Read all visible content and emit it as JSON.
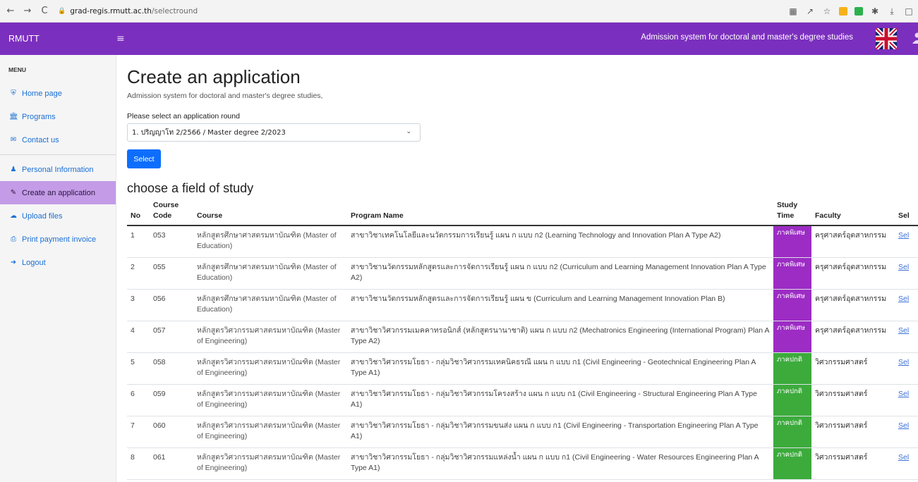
{
  "browser": {
    "url_host": "grad-regis.rmutt.ac.th",
    "url_path": "/selectround"
  },
  "header": {
    "brand": "RMUTT",
    "title": "Admission system for doctoral and master's degree studies"
  },
  "sidebar": {
    "heading": "MENU",
    "items": [
      {
        "label": "Home page",
        "icon": "home-icon"
      },
      {
        "label": "Programs",
        "icon": "university-icon"
      },
      {
        "label": "Contact us",
        "icon": "envelope-icon"
      },
      {
        "label": "Personal Information",
        "icon": "user-icon"
      },
      {
        "label": "Create an application",
        "icon": "file-signature-icon",
        "active": true
      },
      {
        "label": "Upload files",
        "icon": "cloud-upload-icon"
      },
      {
        "label": "Print payment invoice",
        "icon": "print-icon"
      },
      {
        "label": "Logout",
        "icon": "sign-out-icon"
      }
    ]
  },
  "main": {
    "title": "Create an application",
    "subtitle": "Admission system for doctoral and master's degree studies,",
    "round_label": "Please select an application round",
    "round_value": "1. ปริญญาโท 2/2566 / Master degree 2/2023",
    "select_button": "Select",
    "section_title": "choose a field of study"
  },
  "table": {
    "headers": {
      "no": "No",
      "code": "Course Code",
      "course": "Course",
      "program": "Program Name",
      "time": "Study Time",
      "faculty": "Faculty",
      "select": "Sel"
    },
    "rows": [
      {
        "no": "1",
        "code": "053",
        "course": "หลักสูตรศึกษาศาสตรมหาบัณฑิต (Master of Education)",
        "program": "สาขาวิชาเทคโนโลยีและนวัตกรรมการเรียนรู้ แผน ก แบบ ก2 (Learning Technology and Innovation Plan A Type A2)",
        "time": "ภาคพิเศษ",
        "time_type": "special",
        "faculty": "ครุศาสตร์อุตสาหกรรม",
        "select": "Sel"
      },
      {
        "no": "2",
        "code": "055",
        "course": "หลักสูตรศึกษาศาสตรมหาบัณฑิต (Master of Education)",
        "program": "สาขาวิชานวัตกรรมหลักสูตรและการจัดการเรียนรู้ แผน ก แบบ ก2 (Curriculum and Learning Management Innovation Plan A Type A2)",
        "time": "ภาคพิเศษ",
        "time_type": "special",
        "faculty": "ครุศาสตร์อุตสาหกรรม",
        "select": "Sel"
      },
      {
        "no": "3",
        "code": "056",
        "course": "หลักสูตรศึกษาศาสตรมหาบัณฑิต (Master of Education)",
        "program": "สาขาวิชานวัตกรรมหลักสูตรและการจัดการเรียนรู้ แผน ข (Curriculum and Learning Management Innovation Plan B)",
        "time": "ภาคพิเศษ",
        "time_type": "special",
        "faculty": "ครุศาสตร์อุตสาหกรรม",
        "select": "Sel"
      },
      {
        "no": "4",
        "code": "057",
        "course": "หลักสูตรวิศวกรรมศาสตรมหาบัณฑิต (Master of Engineering)",
        "program": "สาขาวิชาวิศวกรรมเมคคาทรอนิกส์ (หลักสูตรนานาชาติ) แผน ก แบบ ก2 (Mechatronics Engineering (International Program) Plan A Type A2)",
        "time": "ภาคพิเศษ",
        "time_type": "special",
        "faculty": "ครุศาสตร์อุตสาหกรรม",
        "select": "Sel"
      },
      {
        "no": "5",
        "code": "058",
        "course": "หลักสูตรวิศวกรรมศาสตรมหาบัณฑิต (Master of Engineering)",
        "program": "สาขาวิชาวิศวกรรมโยธา - กลุ่มวิชาวิศวกรรมเทคนิคธรณี แผน ก แบบ ก1 (Civil Engineering - Geotechnical Engineering Plan A Type A1)",
        "time": "ภาคปกติ",
        "time_type": "normal",
        "faculty": "วิศวกรรมศาสตร์",
        "select": "Sel"
      },
      {
        "no": "6",
        "code": "059",
        "course": "หลักสูตรวิศวกรรมศาสตรมหาบัณฑิต (Master of Engineering)",
        "program": "สาขาวิชาวิศวกรรมโยธา - กลุ่มวิชาวิศวกรรมโครงสร้าง แผน ก แบบ ก1 (Civil Engineering - Structural Engineering Plan A Type A1)",
        "time": "ภาคปกติ",
        "time_type": "normal",
        "faculty": "วิศวกรรมศาสตร์",
        "select": "Sel"
      },
      {
        "no": "7",
        "code": "060",
        "course": "หลักสูตรวิศวกรรมศาสตรมหาบัณฑิต (Master of Engineering)",
        "program": "สาขาวิชาวิศวกรรมโยธา - กลุ่มวิชาวิศวกรรมขนส่ง แผน ก แบบ ก1 (Civil Engineering - Transportation Engineering Plan A Type A1)",
        "time": "ภาคปกติ",
        "time_type": "normal",
        "faculty": "วิศวกรรมศาสตร์",
        "select": "Sel"
      },
      {
        "no": "8",
        "code": "061",
        "course": "หลักสูตรวิศวกรรมศาสตรมหาบัณฑิต (Master of Engineering)",
        "program": "สาขาวิชาวิศวกรรมโยธา - กลุ่มวิชาวิศวกรรมแหล่งน้ำ แผน ก แบบ ก1 (Civil Engineering - Water Resources Engineering Plan A Type A1)",
        "time": "ภาคปกติ",
        "time_type": "normal",
        "faculty": "วิศวกรรมศาสตร์",
        "select": "Sel"
      }
    ]
  },
  "colors": {
    "brand_purple": "#7b2fbe",
    "active_sidebar": "#c39be6",
    "special_time": "#9c2cc4",
    "normal_time": "#3cab3c",
    "primary_button": "#0d6efd"
  }
}
